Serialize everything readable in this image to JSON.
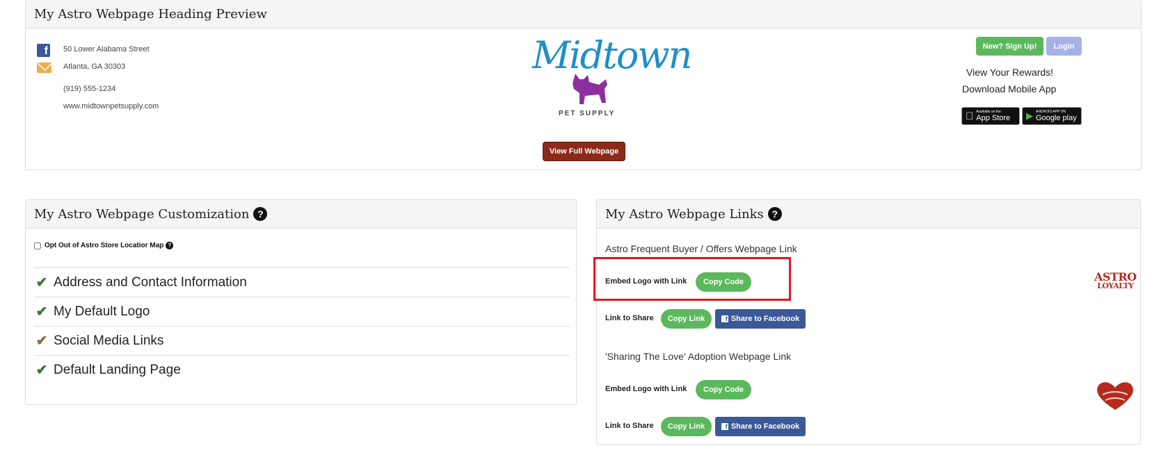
{
  "preview": {
    "title": "My Astro Webpage Heading Preview",
    "address_line1": "50 Lower Alabama Street",
    "address_line2": "Atlanta, GA 30303",
    "phone": "(919) 555-1234",
    "website": "www.midtownpetsupply.com",
    "logo_name": "Midtown",
    "logo_sub": "PET SUPPLY",
    "view_button": "View Full Webpage",
    "signup_button": "New? Sign Up!",
    "login_button": "Login",
    "rewards_link": "View Your Rewards!",
    "download_link": "Download Mobile App",
    "app_store": {
      "small": "Available on the",
      "big": "App Store"
    },
    "google_play": {
      "small": "ANDROID APP ON",
      "big": "Google play"
    }
  },
  "custom": {
    "title": "My Astro Webpage Customization",
    "optout_label": "Opt Out of Astro Store Locatior Map",
    "items": [
      {
        "label": "Address and Contact Information",
        "status": "complete"
      },
      {
        "label": "My Default Logo",
        "status": "complete"
      },
      {
        "label": "Social Media Links",
        "status": "partial"
      },
      {
        "label": "Default Landing Page",
        "status": "complete"
      }
    ]
  },
  "links": {
    "title": "My Astro Webpage Links",
    "section1_title": "Astro Frequent Buyer / Offers Webpage Link",
    "section2_title": "'Sharing The Love' Adoption Webpage Link",
    "embed_label": "Embed Logo with Link",
    "copy_code": "Copy Code",
    "link_label": "Link to Share",
    "copy_link": "Copy Link",
    "share_fb": "Share to Facebook",
    "astro_logo": {
      "line1": "ASTRO",
      "line2": "LOYALTY"
    }
  },
  "colors": {
    "green": "#5cb85c",
    "facebook": "#3b5998",
    "view_button": "#8b2a1a",
    "highlight": "#e8141c"
  }
}
